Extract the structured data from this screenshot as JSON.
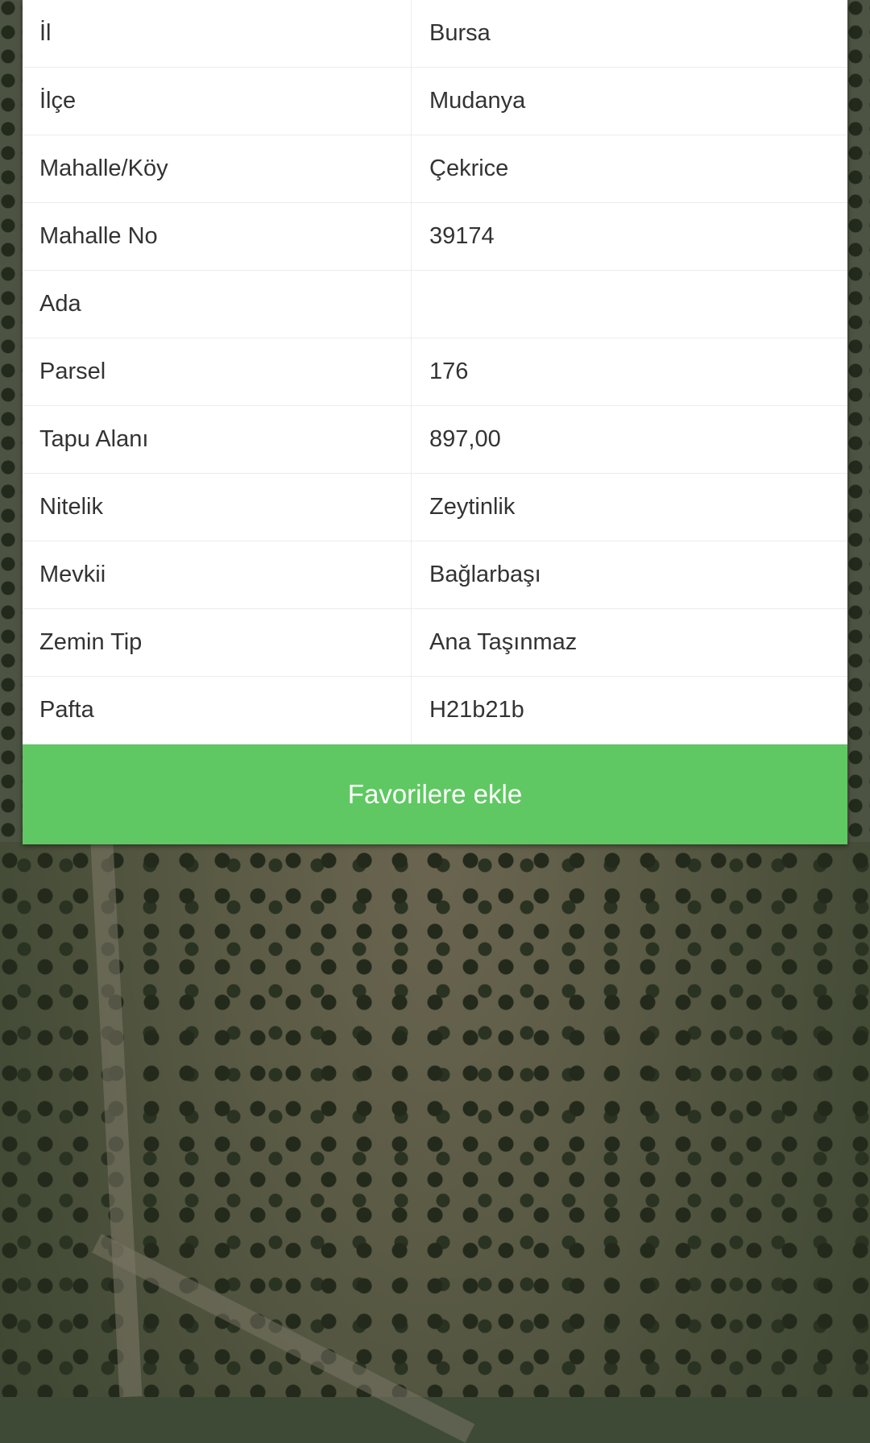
{
  "parcel_info": {
    "rows": [
      {
        "label": "İl",
        "value": "Bursa"
      },
      {
        "label": "İlçe",
        "value": "Mudanya"
      },
      {
        "label": "Mahalle/Köy",
        "value": "Çekrice"
      },
      {
        "label": "Mahalle No",
        "value": "39174"
      },
      {
        "label": "Ada",
        "value": ""
      },
      {
        "label": "Parsel",
        "value": "176"
      },
      {
        "label": "Tapu Alanı",
        "value": "897,00"
      },
      {
        "label": "Nitelik",
        "value": "Zeytinlik"
      },
      {
        "label": "Mevkii",
        "value": "Bağlarbaşı"
      },
      {
        "label": "Zemin Tip",
        "value": "Ana Taşınmaz"
      },
      {
        "label": "Pafta",
        "value": "H21b21b"
      }
    ]
  },
  "actions": {
    "favorite_label": "Favorilere ekle"
  },
  "colors": {
    "button_green": "#5fc862"
  }
}
